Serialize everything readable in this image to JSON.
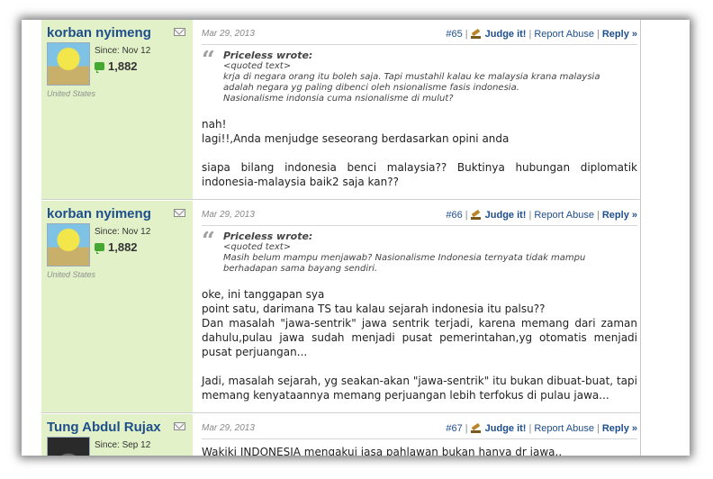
{
  "posts": [
    {
      "username": "korban nyimeng",
      "since": "Since: Nov 12",
      "rep": "1,882",
      "location": "United States",
      "date": "Mar 29, 2013",
      "num": "#65",
      "judge": "Judge it!",
      "report": "Report Abuse",
      "reply": "Reply »",
      "quote_author": "Priceless wrote:",
      "quote_label": "<quoted text>",
      "quote_lines": [
        "krja di negara orang itu boleh saja. Tapi mustahil kalau ke malaysia krana malaysia",
        "adalah negara yg paling dibenci oleh nsionalisme fasis indonesia.",
        "Nasionalisme indonsia cuma nsionalisme di mulut?"
      ],
      "text_lines": [
        "nah!",
        "lagi!!,Anda menjudge seseorang berdasarkan opini anda",
        "",
        "siapa bilang indonesia benci malaysia?? Buktinya hubungan diplomatik indonesia-malaysia baik2 saja kan??"
      ]
    },
    {
      "username": "korban nyimeng",
      "since": "Since: Nov 12",
      "rep": "1,882",
      "location": "United States",
      "date": "Mar 29, 2013",
      "num": "#66",
      "judge": "Judge it!",
      "report": "Report Abuse",
      "reply": "Reply »",
      "quote_author": "Priceless wrote:",
      "quote_label": "<quoted text>",
      "quote_lines": [
        "Masih belum mampu menjawab? Nasionalisme Indonesia ternyata tidak mampu",
        "berhadapan sama bayang sendiri."
      ],
      "text_lines": [
        "oke, ini tanggapan sya",
        "point satu, darimana TS tau kalau sejarah indonesia itu palsu??",
        "Dan masalah \"jawa-sentrik\" jawa sentrik terjadi, karena memang dari zaman dahulu,pulau jawa sudah menjadi pusat pemerintahan,yg otomatis menjadi pusat perjuangan...",
        "",
        "Jadi, masalah sejarah, yg seakan-akan \"jawa-sentrik\" itu bukan dibuat-buat, tapi memang kenyataannya memang perjuangan lebih terfokus di pulau jawa..."
      ]
    },
    {
      "username": "Tung Abdul Rujax",
      "since": "Since: Sep 12",
      "date": "Mar 29, 2013",
      "num": "#67",
      "judge": "Judge it!",
      "report": "Report Abuse",
      "reply": "Reply »",
      "text_lines": [
        "Wakiki INDONESIA mengakui jasa pahlawan bukan hanya dr jawa.."
      ]
    }
  ]
}
